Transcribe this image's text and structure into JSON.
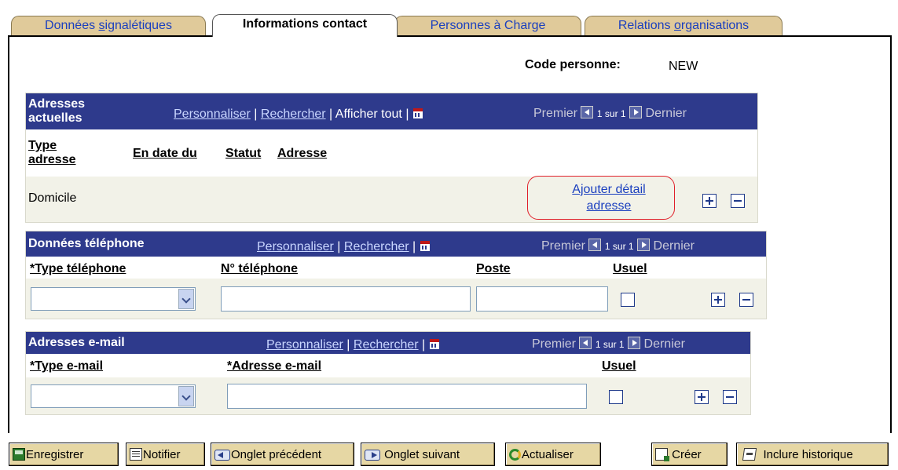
{
  "tabs": [
    {
      "label_pre": "Données ",
      "label_u": "s",
      "label_post": "ignalétiques"
    },
    {
      "label": "Informations contact"
    },
    {
      "label": "Personnes à Charge"
    },
    {
      "label_pre": "Relations ",
      "label_u": "o",
      "label_post": "rganisations"
    }
  ],
  "person": {
    "code_label": "Code personne:",
    "code_value": "NEW"
  },
  "common": {
    "personnaliser": "Personnaliser",
    "rechercher": "Rechercher",
    "afficher_tout": "Afficher tout",
    "separator": "|",
    "premier": "Premier",
    "sur": "1 sur 1",
    "dernier": "Dernier"
  },
  "addresses": {
    "title_line1": "Adresses",
    "title_line2": "actuelles",
    "col_type_line1": "Type",
    "col_type_line2": "adresse",
    "col_date": "En date du",
    "col_statut": "Statut",
    "col_adresse": "Adresse",
    "row": {
      "type": "Domicile",
      "link_line1": "Ajouter détail",
      "link_line2": "adresse"
    }
  },
  "phone": {
    "title": "Données téléphone",
    "col_type": "*Type téléphone",
    "col_num": "N° téléphone",
    "col_poste": "Poste",
    "col_usuel": "Usuel"
  },
  "email": {
    "title": "Adresses e-mail",
    "col_type": "*Type e-mail",
    "col_addr": "*Adresse e-mail",
    "col_usuel": "Usuel"
  },
  "toolbar": {
    "save": "Enregistrer",
    "notify": "Notifier",
    "prev": "Onglet précédent",
    "next": "Onglet suivant",
    "refresh": "Actualiser",
    "create": "Créer",
    "history": "Inclure historique"
  }
}
